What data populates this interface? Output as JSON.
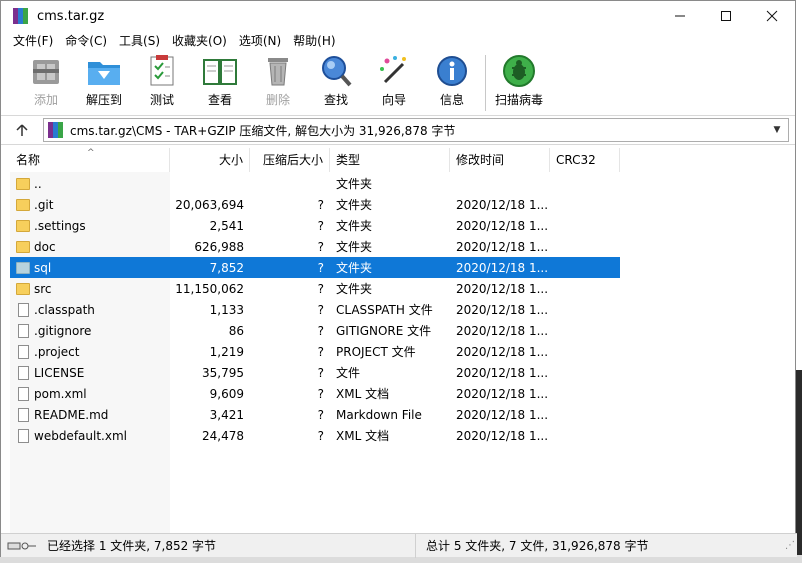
{
  "window": {
    "title": "cms.tar.gz"
  },
  "menu": [
    "文件(F)",
    "命令(C)",
    "工具(S)",
    "收藏夹(O)",
    "选项(N)",
    "帮助(H)"
  ],
  "toolbar": [
    {
      "label": "添加",
      "icon": "add-archive-icon",
      "disabled": true
    },
    {
      "label": "解压到",
      "icon": "extract-folder-icon",
      "disabled": false
    },
    {
      "label": "测试",
      "icon": "test-checklist-icon",
      "disabled": false
    },
    {
      "label": "查看",
      "icon": "view-book-icon",
      "disabled": false
    },
    {
      "label": "删除",
      "icon": "trash-icon",
      "disabled": true
    },
    {
      "label": "查找",
      "icon": "find-magnifier-icon",
      "disabled": false
    },
    {
      "label": "向导",
      "icon": "wizard-wand-icon",
      "disabled": false
    },
    {
      "label": "信息",
      "icon": "info-icon",
      "disabled": false
    },
    {
      "label": "扫描病毒",
      "icon": "virus-scan-icon",
      "disabled": false
    }
  ],
  "address": {
    "path": "cms.tar.gz\\CMS - TAR+GZIP 压缩文件, 解包大小为 31,926,878 字节"
  },
  "columns": [
    "名称",
    "大小",
    "压缩后大小",
    "类型",
    "修改时间",
    "CRC32"
  ],
  "files": [
    {
      "name": "..",
      "size": "",
      "packed": "",
      "type": "文件夹",
      "modified": "",
      "kind": "folder",
      "selected": false
    },
    {
      "name": ".git",
      "size": "20,063,694",
      "packed": "?",
      "type": "文件夹",
      "modified": "2020/12/18 1...",
      "kind": "folder",
      "selected": false
    },
    {
      "name": ".settings",
      "size": "2,541",
      "packed": "?",
      "type": "文件夹",
      "modified": "2020/12/18 1...",
      "kind": "folder",
      "selected": false
    },
    {
      "name": "doc",
      "size": "626,988",
      "packed": "?",
      "type": "文件夹",
      "modified": "2020/12/18 1...",
      "kind": "folder",
      "selected": false
    },
    {
      "name": "sql",
      "size": "7,852",
      "packed": "?",
      "type": "文件夹",
      "modified": "2020/12/18 1...",
      "kind": "folder",
      "selected": true
    },
    {
      "name": "src",
      "size": "11,150,062",
      "packed": "?",
      "type": "文件夹",
      "modified": "2020/12/18 1...",
      "kind": "folder",
      "selected": false
    },
    {
      "name": ".classpath",
      "size": "1,133",
      "packed": "?",
      "type": "CLASSPATH 文件",
      "modified": "2020/12/18 1...",
      "kind": "file",
      "selected": false
    },
    {
      "name": ".gitignore",
      "size": "86",
      "packed": "?",
      "type": "GITIGNORE 文件",
      "modified": "2020/12/18 1...",
      "kind": "file",
      "selected": false
    },
    {
      "name": ".project",
      "size": "1,219",
      "packed": "?",
      "type": "PROJECT 文件",
      "modified": "2020/12/18 1...",
      "kind": "file",
      "selected": false
    },
    {
      "name": "LICENSE",
      "size": "35,795",
      "packed": "?",
      "type": "文件",
      "modified": "2020/12/18 1...",
      "kind": "file",
      "selected": false
    },
    {
      "name": "pom.xml",
      "size": "9,609",
      "packed": "?",
      "type": "XML 文档",
      "modified": "2020/12/18 1...",
      "kind": "file",
      "selected": false
    },
    {
      "name": "README.md",
      "size": "3,421",
      "packed": "?",
      "type": "Markdown File",
      "modified": "2020/12/18 1...",
      "kind": "file",
      "selected": false
    },
    {
      "name": "webdefault.xml",
      "size": "24,478",
      "packed": "?",
      "type": "XML 文档",
      "modified": "2020/12/18 1...",
      "kind": "file",
      "selected": false
    }
  ],
  "status": {
    "left": "已经选择 1 文件夹, 7,852 字节",
    "right": "总计 5 文件夹, 7 文件, 31,926,878 字节"
  },
  "colors": {
    "selection": "#0f78d7",
    "folder": "#f7cf5c"
  }
}
